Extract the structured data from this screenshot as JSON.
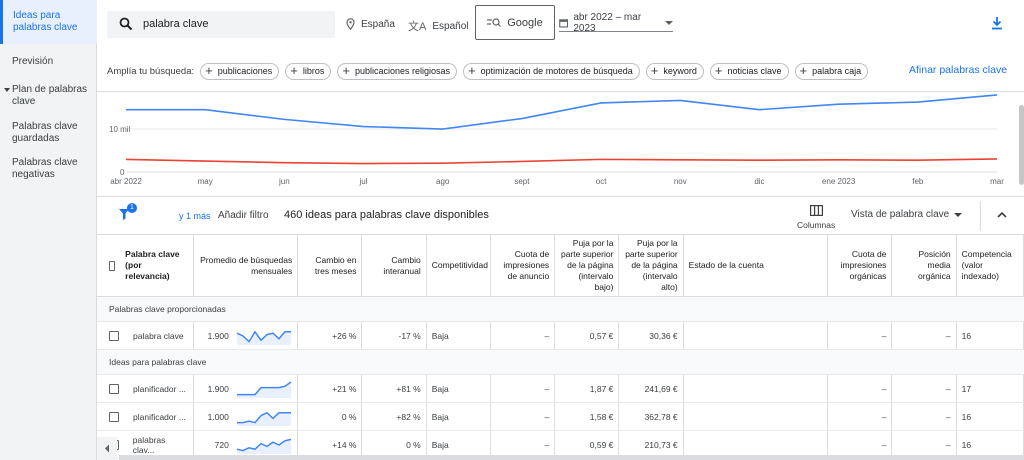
{
  "sidebar": {
    "items": [
      {
        "label": "Ideas para palabras clave",
        "active": true
      },
      {
        "label": "Previsión"
      },
      {
        "label": "Plan de palabras clave",
        "caret": true
      },
      {
        "label": "Palabras clave guardadas"
      },
      {
        "label": "Palabras clave negativas"
      }
    ]
  },
  "topbar": {
    "search_value": "palabra clave",
    "location": "España",
    "language": "Español",
    "network": "Google",
    "date_range": "abr 2022 – mar 2023",
    "download_icon": "download-icon"
  },
  "broaden": {
    "label": "Amplía tu búsqueda:",
    "chips": [
      "publicaciones",
      "libros",
      "publicaciones religiosas",
      "optimización de motores de búsqueda",
      "keyword",
      "noticias clave",
      "palabra caja"
    ],
    "refine": "Afinar palabras clave"
  },
  "chart": {
    "y_tick": "10 mil",
    "y_zero": "0",
    "months": [
      "abr 2022",
      "may",
      "jun",
      "jul",
      "ago",
      "sept",
      "oct",
      "nov",
      "dic",
      "ene 2023",
      "feb",
      "mar"
    ],
    "colors": {
      "blue": "#4285f4",
      "red": "#ea4335"
    }
  },
  "chart_data": {
    "type": "line",
    "categories": [
      "abr 2022",
      "may",
      "jun",
      "jul",
      "ago",
      "sept",
      "oct",
      "nov",
      "dic",
      "ene 2023",
      "feb",
      "mar"
    ],
    "ylim": [
      0,
      19000
    ],
    "series": [
      {
        "values": [
          14800,
          14800,
          12500,
          10800,
          10200,
          12700,
          16400,
          17000,
          14800,
          16100,
          16600,
          18300
        ],
        "color": "#4285f4"
      },
      {
        "values": [
          3000,
          2600,
          2200,
          2000,
          2100,
          2500,
          3000,
          2900,
          2800,
          2900,
          2800,
          3100
        ],
        "color": "#ea4335"
      }
    ]
  },
  "filter": {
    "badge": "1",
    "more": "y 1 más",
    "add_filter": "Añadir filtro",
    "count_text": "460 ideas para palabras clave disponibles",
    "columns": "Columnas",
    "view": "Vista de palabra clave"
  },
  "table": {
    "headers": [
      "Palabra clave (por relevancia)",
      "Promedio de búsquedas mensuales",
      "Cambio en tres meses",
      "Cambio interanual",
      "Competitividad",
      "Cuota de impresiones de anuncio",
      "Puja por la parte superior de la página (intervalo bajo)",
      "Puja por la parte superior de la página (intervalo alto)",
      "Estado de la cuenta",
      "Cuota de impresiones orgánicas",
      "Posición media orgánica",
      "Competencia (valor indexado)"
    ],
    "section1": "Palabras clave proporcionadas",
    "section2": "Ideas para palabras clave",
    "rows1": [
      {
        "kw": "palabra clave",
        "avg": "1.900",
        "three": "+26 %",
        "yoy": "-17 %",
        "comp": "Baja",
        "share": "–",
        "low": "0,57 €",
        "high": "30,36 €",
        "org": "–",
        "pos": "–",
        "idx": "16",
        "spark": [
          0.7,
          0.5,
          0.1,
          0.8,
          0.2,
          0.6,
          0.7,
          0.3,
          0.8,
          0.8
        ]
      }
    ],
    "rows2": [
      {
        "kw": "planificador ...",
        "avg": "1.900",
        "three": "+21 %",
        "yoy": "+81 %",
        "comp": "Baja",
        "share": "–",
        "low": "1,87 €",
        "high": "241,69 €",
        "org": "–",
        "pos": "–",
        "idx": "17",
        "spark": [
          0.1,
          0.1,
          0.1,
          0.1,
          0.6,
          0.6,
          0.6,
          0.6,
          0.7,
          1.0
        ]
      },
      {
        "kw": "planificador ...",
        "avg": "1.000",
        "three": "0 %",
        "yoy": "+82 %",
        "comp": "Baja",
        "share": "–",
        "low": "1,58 €",
        "high": "362,78 €",
        "org": "–",
        "pos": "–",
        "idx": "16",
        "spark": [
          0.1,
          0.1,
          0.2,
          0.1,
          0.6,
          0.8,
          0.4,
          0.8,
          0.8,
          0.8
        ]
      },
      {
        "kw": "palabras clav...",
        "avg": "720",
        "three": "+14 %",
        "yoy": "0 %",
        "comp": "Baja",
        "share": "–",
        "low": "0,59 €",
        "high": "210,73 €",
        "org": "–",
        "pos": "–",
        "idx": "16",
        "spark": [
          0.2,
          0.1,
          0.3,
          0.2,
          0.6,
          0.4,
          0.7,
          0.5,
          0.8,
          0.9
        ]
      }
    ]
  }
}
